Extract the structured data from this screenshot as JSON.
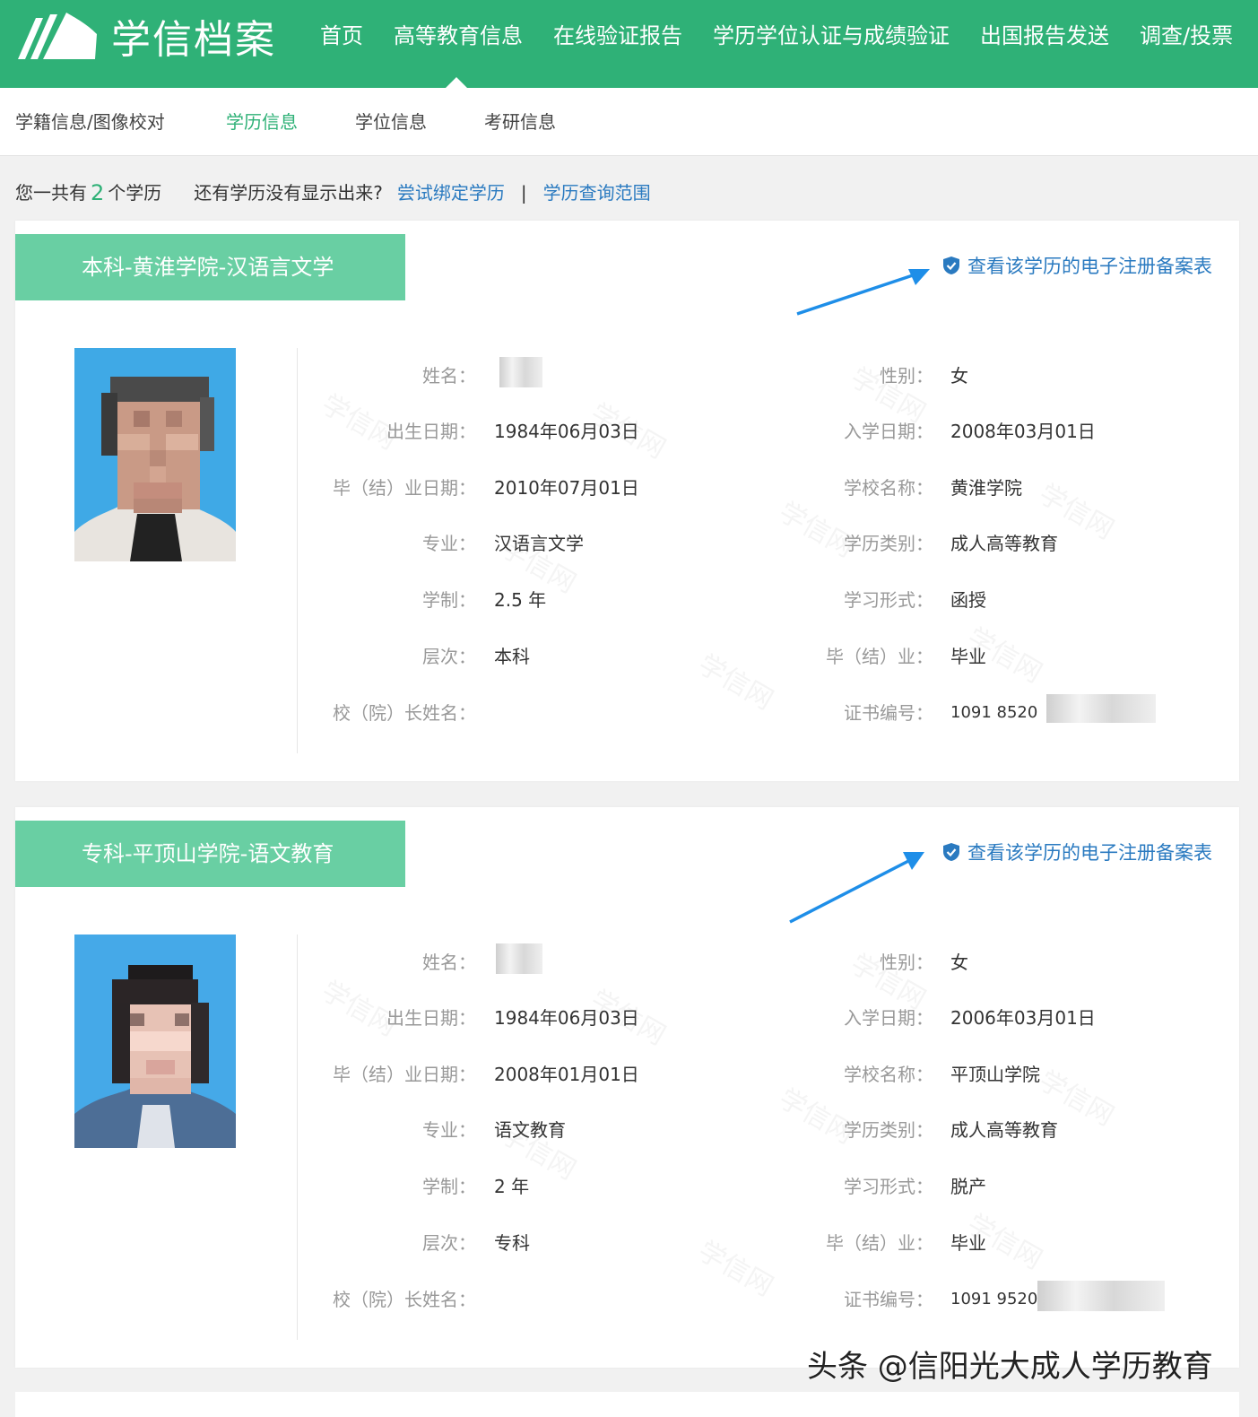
{
  "brand": {
    "title": "学信档案"
  },
  "main_nav": [
    {
      "label": "首页"
    },
    {
      "label": "高等教育信息"
    },
    {
      "label": "在线验证报告"
    },
    {
      "label": "学历学位认证与成绩验证"
    },
    {
      "label": "出国报告发送"
    },
    {
      "label": "调查/投票"
    }
  ],
  "sub_nav": [
    {
      "label": "学籍信息/图像校对"
    },
    {
      "label": "学历信息"
    },
    {
      "label": "学位信息"
    },
    {
      "label": "考研信息"
    }
  ],
  "summary": {
    "prefix": "您一共有",
    "count": "2",
    "suffix": "个学历",
    "question": "还有学历没有显示出来?",
    "link_bind": "尝试绑定学历",
    "separator": "|",
    "link_scope": "学历查询范围"
  },
  "labels": {
    "name": "姓名：",
    "gender": "性别：",
    "birth": "出生日期：",
    "enroll": "入学日期：",
    "graduate_date": "毕（结）业日期：",
    "school": "学校名称：",
    "major": "专业：",
    "edu_type": "学历类别：",
    "duration": "学制：",
    "study_form": "学习形式：",
    "level": "层次：",
    "graduation": "毕（结）业：",
    "principal": "校（院）长姓名：",
    "cert_no": "证书编号："
  },
  "verify_link": "查看该学历的电子注册备案表",
  "watermark_text": "学信网",
  "records": [
    {
      "title": "本科-黄淮学院-汉语言文学",
      "gender": "女",
      "birth": "1984年06月03日",
      "enroll": "2008年03月01日",
      "graduate_date": "2010年07月01日",
      "school": "黄淮学院",
      "major": "汉语言文学",
      "edu_type": "成人高等教育",
      "duration": "2.5 年",
      "study_form": "函授",
      "level": "本科",
      "graduation": "毕业",
      "principal": "",
      "cert_no": "1091 8520"
    },
    {
      "title": "专科-平顶山学院-语文教育",
      "gender": "女",
      "birth": "1984年06月03日",
      "enroll": "2006年03月01日",
      "graduate_date": "2008年01月01日",
      "school": "平顶山学院",
      "major": "语文教育",
      "edu_type": "成人高等教育",
      "duration": "2 年",
      "study_form": "脱产",
      "level": "专科",
      "graduation": "毕业",
      "principal": "",
      "cert_no": "1091 9520"
    }
  ],
  "overlay_watermark": "头条 @信阳光大成人学历教育",
  "colors": {
    "primary": "#2fb177",
    "title_band": "#69cfa3",
    "link": "#2a7ac0",
    "arrow": "#1e8ee8"
  }
}
